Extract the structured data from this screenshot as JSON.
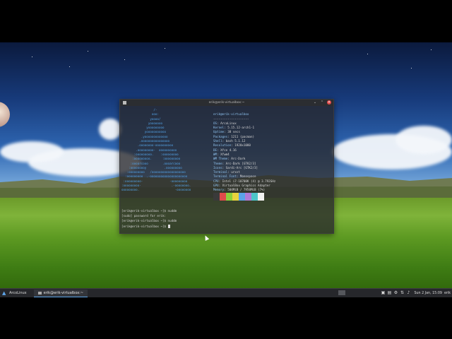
{
  "window": {
    "title": "erik@erik-virtualbox:~",
    "minimize": "⌄",
    "maximize": "⌃",
    "close": "×"
  },
  "neofetch": {
    "art": "                  /-\n                 ooo:\n                yoooo/\n               yooooooo\n              yooooooooo\n             yooooooooooo\n           .yooooooooooooo\n          .oooooooooooooooo\n         .oooooooo-oooooooooo\n        .ooooooooo-  oooooooooo\n       :ooooooooo.    :ooooooooo\n      :ooooooooo.      :ooooooooo\n     :oooarcooo        .oooarcooo\n    :ooooooooy          .ooooooooo\n   :ooooooooo   /ooooooooooooooooooo\n  :ooooooooo  .-ooooooooooooooooooooo\n :ooooooooo-               -ooooooooo\n:ooooooooo-                 .-oooooooo.\nooooooooo.                    -oooooooo",
    "header": "erik@erik-virtualbox",
    "separator": "--------------------",
    "fields": [
      {
        "key": "OS",
        "value": "ArcoLinux"
      },
      {
        "key": "Kernel",
        "value": "5.15.12-arch1-1"
      },
      {
        "key": "Uptime",
        "value": "38 secs"
      },
      {
        "key": "Packages",
        "value": "1211 (pacman)"
      },
      {
        "key": "Shell",
        "value": "bash 5.1.12"
      },
      {
        "key": "Resolution",
        "value": "1920x1080"
      },
      {
        "key": "DE",
        "value": "Xfce 4.16"
      },
      {
        "key": "WM",
        "value": "Xfwm4"
      },
      {
        "key": "WM Theme",
        "value": "Arc-Dark"
      },
      {
        "key": "Theme",
        "value": "Arc-Dark [GTK2/3]"
      },
      {
        "key": "Icons",
        "value": "Sardi-Arc [GTK2/3]"
      },
      {
        "key": "Terminal",
        "value": "urxvt"
      },
      {
        "key": "Terminal Font",
        "value": "Monospace"
      },
      {
        "key": "CPU",
        "value": "Intel i7-10700K (4) @ 3.792GHz"
      },
      {
        "key": "GPU",
        "value": "VirtualBox Graphics Adapter"
      },
      {
        "key": "Memory",
        "value": "504MiB / 7950MiB (7%)"
      }
    ],
    "palette": [
      "#3a3a3a",
      "#e04b4b",
      "#8ccf3c",
      "#e8d33e",
      "#5aa3e8",
      "#b07ad6",
      "#4ec5c9",
      "#f2f2f2"
    ]
  },
  "commands": [
    "[erik@erik-virtualbox ~]$ nuddm",
    "[sudo] password for erik:",
    "[erik@erik-virtualbox ~]$ nuddm",
    "[erik@erik-virtualbox ~]$ "
  ],
  "panel": {
    "menu_label": "ArcoLinux",
    "task_label": "erik@erik-virtualbox:~",
    "clock": "Sun  2 Jan, 15:09",
    "user": "erik"
  }
}
